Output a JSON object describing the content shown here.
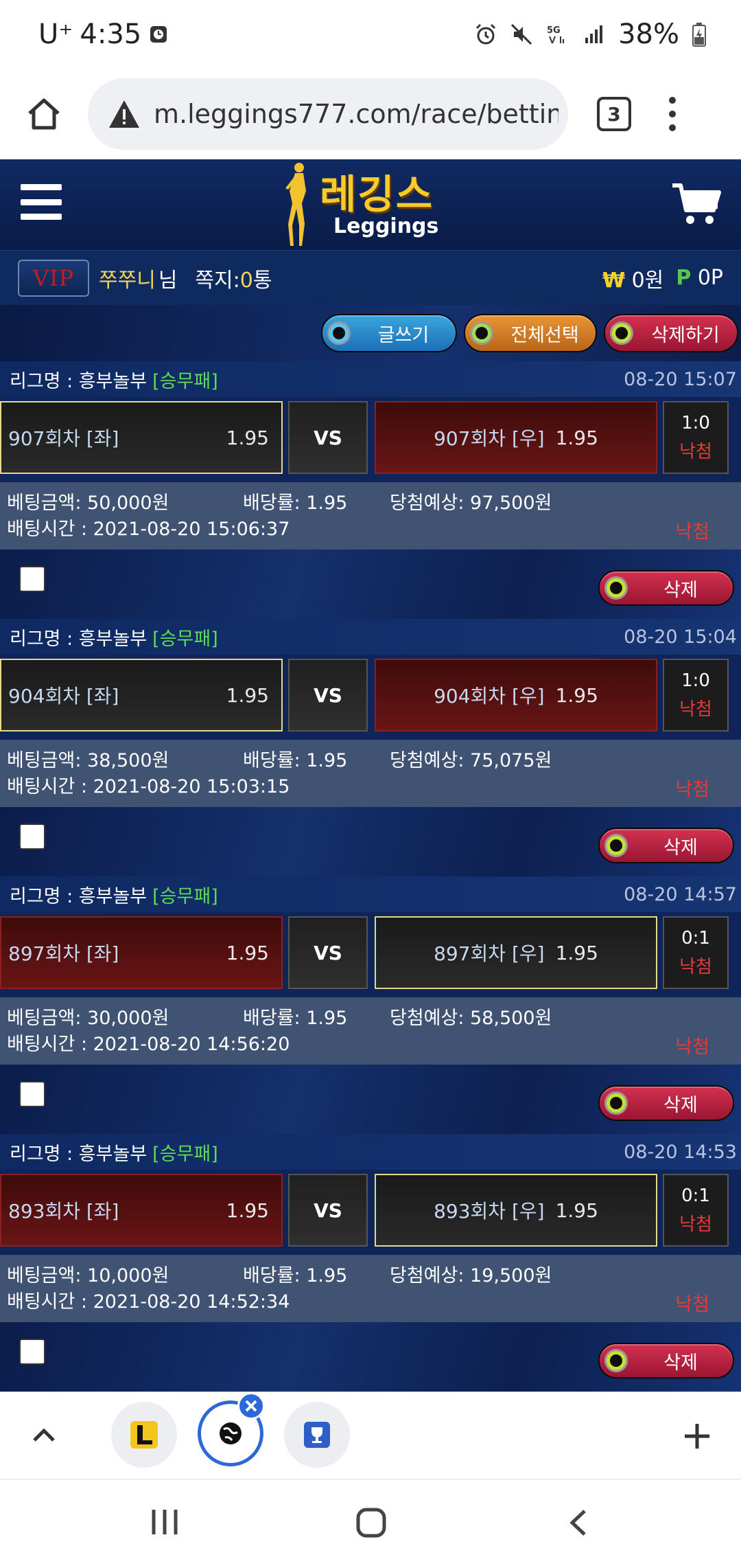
{
  "status_bar": {
    "carrier": "U⁺",
    "time": "4:35",
    "battery": "38%"
  },
  "browser": {
    "url": "m.leggings777.com/race/bettin",
    "tab_count": "3"
  },
  "site": {
    "logo_ko": "레깅스",
    "logo_en": "Leggings",
    "vip_label": "VIP",
    "nickname": "쭈쭈니",
    "nickname_suffix": "님",
    "message_label": "쪽지:",
    "message_count": "0",
    "message_unit": "통",
    "won_symbol": "₩",
    "money": "0원",
    "point_symbol": "P",
    "points": "0P"
  },
  "actions": {
    "write": "글쓰기",
    "select_all": "전체선택",
    "delete_selected": "삭제하기"
  },
  "bets": [
    {
      "league_label": "리그명 : 흥부놀부",
      "bet_type": "[승무패]",
      "datetime": "08-20 15:07",
      "left_team": "907회차 [좌]",
      "left_odds": "1.95",
      "vs": "VS",
      "right_team": "907회차 [우]",
      "right_odds": "1.95",
      "score": "1:0",
      "result": "낙첨",
      "amount": "베팅금액: 50,000원",
      "rate": "배당률: 1.95",
      "expected": "당첨예상: 97,500원",
      "bet_time": "배팅시간 : 2021-08-20 15:06:37",
      "status": "낙첨",
      "delete": "삭제"
    },
    {
      "league_label": "리그명 : 흥부놀부",
      "bet_type": "[승무패]",
      "datetime": "08-20 15:04",
      "left_team": "904회차 [좌]",
      "left_odds": "1.95",
      "vs": "VS",
      "right_team": "904회차 [우]",
      "right_odds": "1.95",
      "score": "1:0",
      "result": "낙첨",
      "amount": "베팅금액: 38,500원",
      "rate": "배당률: 1.95",
      "expected": "당첨예상: 75,075원",
      "bet_time": "배팅시간 : 2021-08-20 15:03:15",
      "status": "낙첨",
      "delete": "삭제"
    },
    {
      "league_label": "리그명 : 흥부놀부",
      "bet_type": "[승무패]",
      "datetime": "08-20 14:57",
      "left_team": "897회차 [좌]",
      "left_odds": "1.95",
      "vs": "VS",
      "right_team": "897회차 [우]",
      "right_odds": "1.95",
      "score": "0:1",
      "result": "낙첨",
      "amount": "베팅금액: 30,000원",
      "rate": "배당률: 1.95",
      "expected": "당첨예상: 58,500원",
      "bet_time": "배팅시간 : 2021-08-20 14:56:20",
      "status": "낙첨",
      "delete": "삭제"
    },
    {
      "league_label": "리그명 : 흥부놀부",
      "bet_type": "[승무패]",
      "datetime": "08-20 14:53",
      "left_team": "893회차 [좌]",
      "left_odds": "1.95",
      "vs": "VS",
      "right_team": "893회차 [우]",
      "right_odds": "1.95",
      "score": "0:1",
      "result": "낙첨",
      "amount": "베팅금액: 10,000원",
      "rate": "배당률: 1.95",
      "expected": "당첨예상: 19,500원",
      "bet_time": "배팅시간 : 2021-08-20 14:52:34",
      "status": "낙첨",
      "delete": "삭제"
    }
  ],
  "colors": {
    "site_bg": "#0d1f4a",
    "accent_gold": "#f7cc2a",
    "lost_red": "#e43a3a",
    "type_green": "#5ddc54"
  }
}
